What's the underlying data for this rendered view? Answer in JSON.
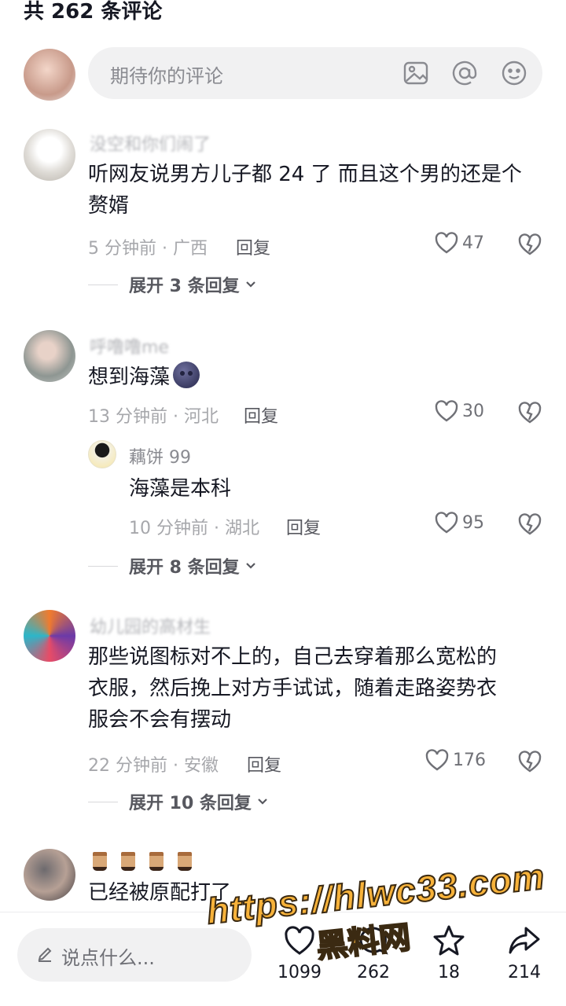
{
  "header": {
    "count_text": "共 262 条评论"
  },
  "composer": {
    "placeholder": "期待你的评论",
    "icons": [
      "image-icon",
      "at-icon",
      "emoji-icon"
    ]
  },
  "comments": [
    {
      "username": "没空和你们闹了",
      "text_lines": [
        "听网友说男方儿子都 24 了 而且这个男的还是个",
        "赘婿"
      ],
      "meta": "5 分钟前 · 广西",
      "reply_label": "回复",
      "likes": "47",
      "expand": "展开 3 条回复"
    },
    {
      "username": "呼噜噜me",
      "text": "想到海藻",
      "meta": "13 分钟前 · 河北",
      "reply_label": "回复",
      "likes": "30",
      "reply": {
        "username": "藕饼 99",
        "text": "海藻是本科",
        "meta": "10 分钟前 · 湖北",
        "reply_label": "回复",
        "likes": "95"
      },
      "expand": "展开 8 条回复"
    },
    {
      "username": "幼儿园的高材生",
      "text_lines": [
        "那些说图标对不上的，自己去穿着那么宽松的",
        "衣服，然后挽上对方手试试，随着走路姿势衣",
        "服会不会有摆动"
      ],
      "meta": "22 分钟前 · 安徽",
      "reply_label": "回复",
      "likes": "176",
      "expand": "展开 10 条回复"
    },
    {
      "username": "",
      "text": "已经被原配打了"
    }
  ],
  "bottom_bar": {
    "input_placeholder": "说点什么...",
    "likes": "1099",
    "comments": "262",
    "favorites": "18",
    "shares": "214"
  },
  "watermark": {
    "line1": "https://hlwc33.com",
    "line2": "黑料网"
  }
}
